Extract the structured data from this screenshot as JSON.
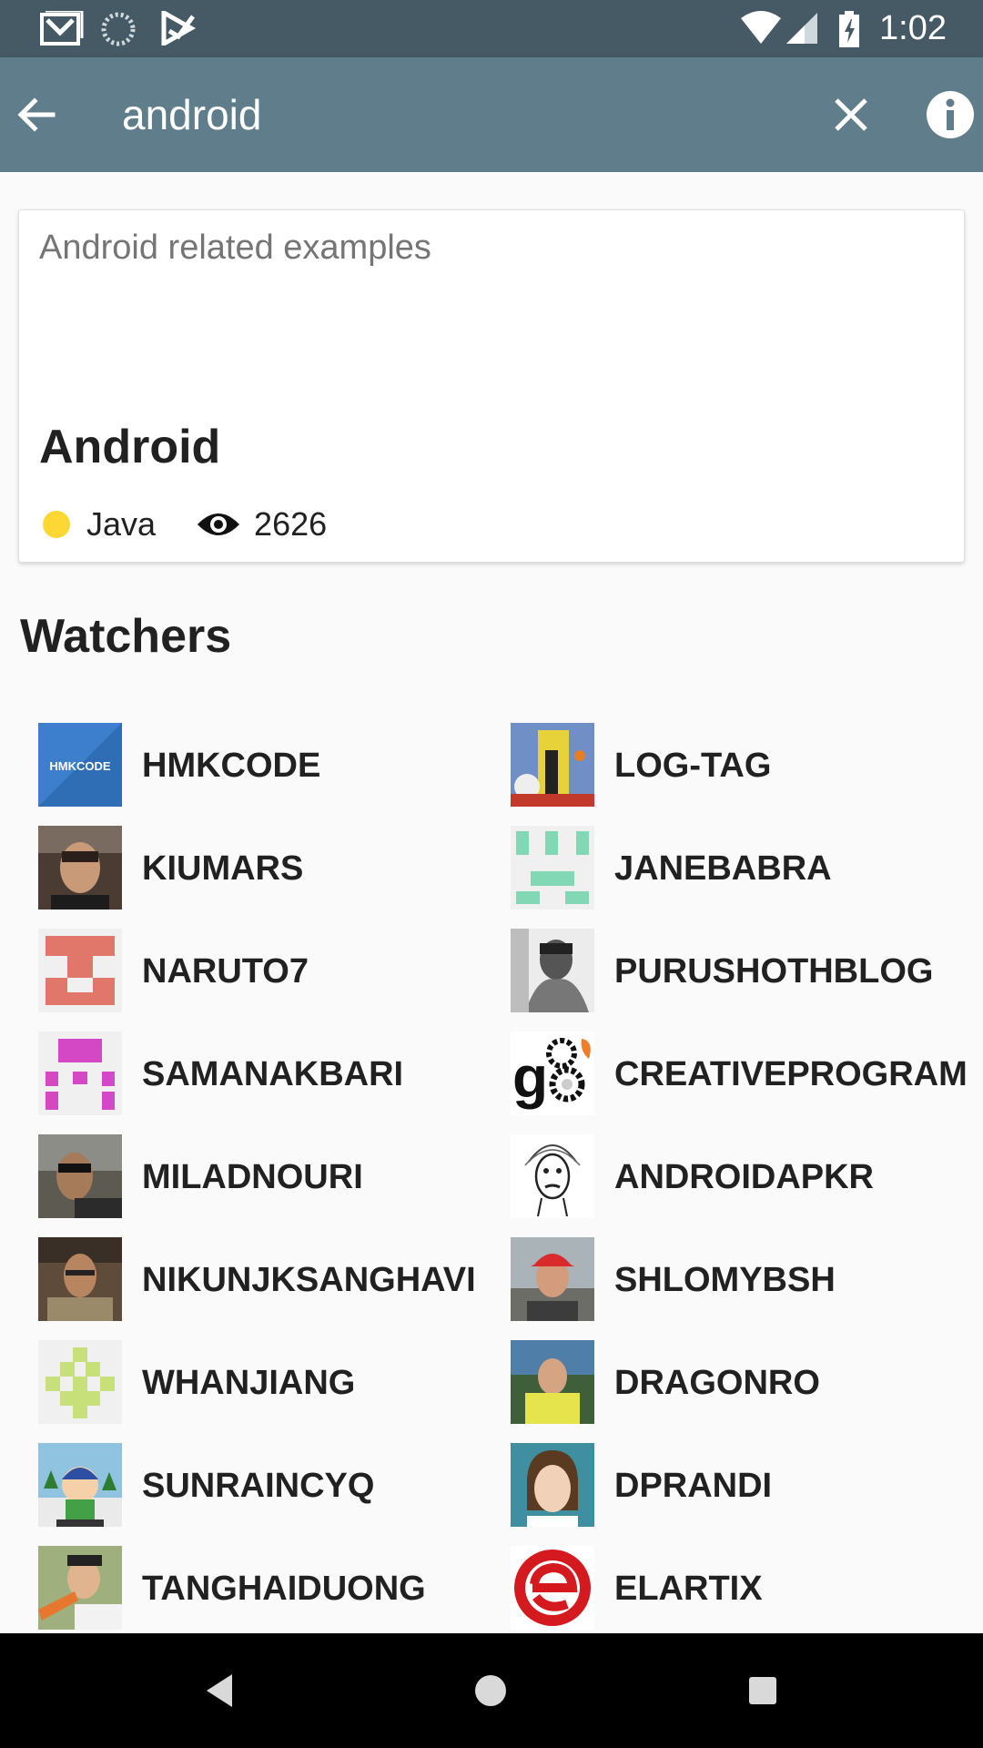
{
  "status_bar": {
    "time": "1:02",
    "left_icons": [
      "gmail-icon",
      "sync-icon",
      "play-store-icon"
    ],
    "right_icons": [
      "wifi-icon",
      "signal-icon",
      "battery-icon"
    ]
  },
  "app_bar": {
    "query": "android",
    "icons": {
      "back": "arrow-left-icon",
      "clear": "close-icon",
      "info": "info-icon"
    }
  },
  "repo": {
    "description": "Android related examples",
    "name": "Android",
    "language": "Java",
    "language_color": "#fdd835",
    "watchers_count": "2626"
  },
  "watchers": {
    "title": "Watchers",
    "items": [
      {
        "name": "HMKCODE",
        "avatar": "hmkcode-logo"
      },
      {
        "name": "LOG-TAG",
        "avatar": "cartoon-image"
      },
      {
        "name": "KIUMARS",
        "avatar": "photo"
      },
      {
        "name": "JANEBABRA",
        "avatar": "identicon-green"
      },
      {
        "name": "NARUTO7",
        "avatar": "identicon-red"
      },
      {
        "name": "PURUSHOTHBLOG",
        "avatar": "photo-bw"
      },
      {
        "name": "SAMANAKBARI",
        "avatar": "identicon-magenta"
      },
      {
        "name": "CREATIVEPROGRAMMI",
        "avatar": "gears-logo"
      },
      {
        "name": "MILADNOURI",
        "avatar": "photo"
      },
      {
        "name": "ANDROIDAPKR",
        "avatar": "einstein-sketch"
      },
      {
        "name": "NIKUNJKSANGHAVI",
        "avatar": "photo"
      },
      {
        "name": "SHLOMYBSH",
        "avatar": "photo"
      },
      {
        "name": "WHANJIANG",
        "avatar": "identicon-lime"
      },
      {
        "name": "DRAGONRO",
        "avatar": "photo"
      },
      {
        "name": "SUNRAINCYQ",
        "avatar": "cartoon-character"
      },
      {
        "name": "DPRANDI",
        "avatar": "caricature"
      },
      {
        "name": "TANGHAIDUONG",
        "avatar": "photo"
      },
      {
        "name": "ELARTIX",
        "avatar": "elartix-logo"
      }
    ]
  },
  "avatar_text": {
    "hmkcode": "HMKCODE"
  },
  "nav_bar": {
    "icons": [
      "back-triangle-icon",
      "home-circle-icon",
      "recents-square-icon"
    ]
  }
}
